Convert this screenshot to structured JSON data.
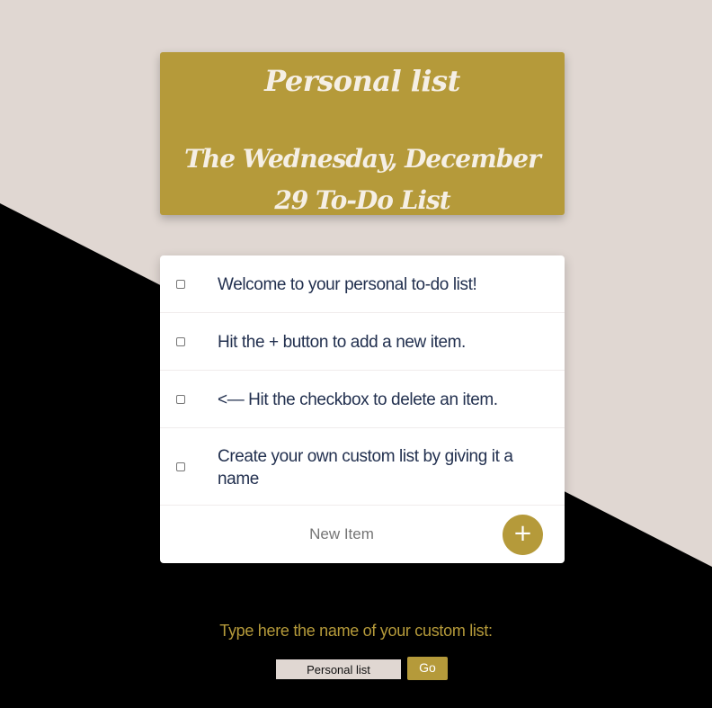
{
  "colors": {
    "accent": "#b59a3a",
    "light_background": "#e0d7d2",
    "dark_background": "#000000",
    "item_text": "#22304f",
    "card": "#ffffff"
  },
  "header": {
    "list_name": "Personal list",
    "title": "The Wednesday, December 29 To-Do List"
  },
  "todo": {
    "items": [
      {
        "text": "Welcome to your personal to-do list!",
        "checked": false
      },
      {
        "text": "Hit the + button to add a new item.",
        "checked": false
      },
      {
        "text": "<— Hit the checkbox to delete an item.",
        "checked": false
      },
      {
        "text": "Create your own custom list by giving it a name",
        "checked": false
      }
    ],
    "new_item_placeholder": "New Item",
    "add_button_label": "+"
  },
  "custom_list": {
    "prompt": "Type here the name of your custom list:",
    "input_value": "Personal list",
    "go_label": "Go"
  }
}
